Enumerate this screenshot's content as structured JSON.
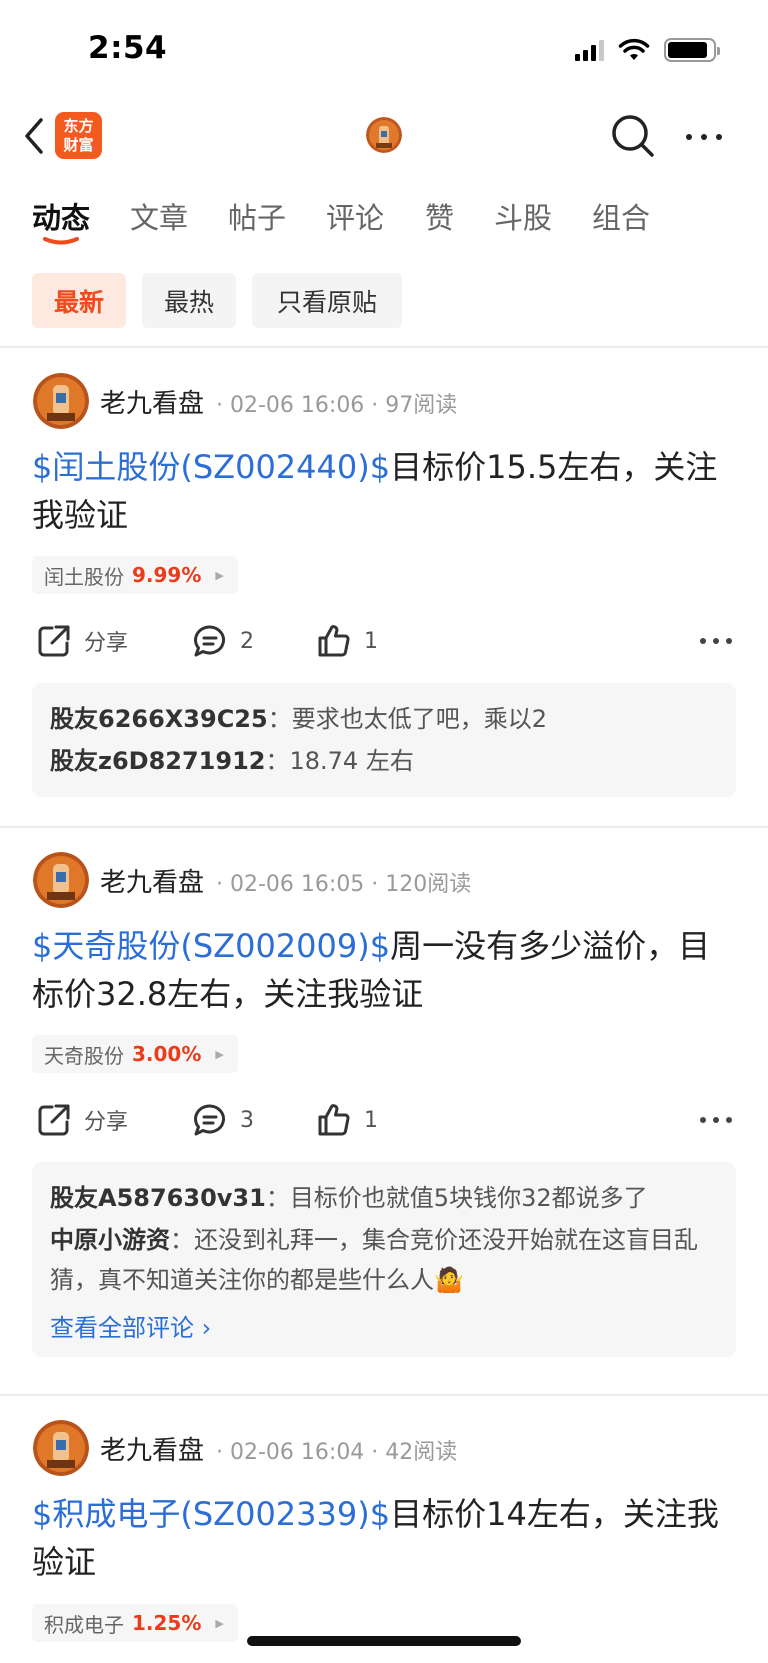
{
  "status_bar": {
    "time": "2:54"
  },
  "nav": {
    "logo_line1": "东方",
    "logo_line2": "财富"
  },
  "tabs": [
    {
      "label": "动态",
      "active": true
    },
    {
      "label": "文章"
    },
    {
      "label": "帖子"
    },
    {
      "label": "评论"
    },
    {
      "label": "赞"
    },
    {
      "label": "斗股"
    },
    {
      "label": "组合"
    }
  ],
  "filters": [
    {
      "label": "最新",
      "active": true
    },
    {
      "label": "最热"
    },
    {
      "label": "只看原贴"
    }
  ],
  "colors": {
    "accent": "#ef4b1d",
    "link": "#2b6fd6",
    "stock_up": "#ea3b1a"
  },
  "posts": [
    {
      "author": "老九看盘",
      "meta": "· 02-06 16:06 · 97阅读",
      "stock_tag": "$闰土股份(SZ002440)$",
      "text": "目标价15.5左右，关注我验证",
      "chip_name": "闰土股份",
      "chip_pct": "9.99%",
      "share_label": "分享",
      "comment_count": "2",
      "like_count": "1",
      "comments": [
        {
          "name": "股友6266X39C25",
          "sep": "：",
          "text": "要求也太低了吧，乘以2"
        },
        {
          "name": "股友z6D8271912",
          "sep": "：",
          "text": "18.74 左右"
        }
      ]
    },
    {
      "author": "老九看盘",
      "meta": "· 02-06 16:05 · 120阅读",
      "stock_tag": "$天奇股份(SZ002009)$",
      "text": "周一没有多少溢价，目标价32.8左右，关注我验证",
      "chip_name": "天奇股份",
      "chip_pct": "3.00%",
      "share_label": "分享",
      "comment_count": "3",
      "like_count": "1",
      "comments": [
        {
          "name": "股友A587630v31",
          "sep": "：",
          "text": "目标价也就值5块钱你32都说多了"
        },
        {
          "name": "中原小游资",
          "sep": "：",
          "text": "还没到礼拜一，集合竞价还没开始就在这盲目乱猜，真不知道关注你的都是些什么人🤷"
        }
      ],
      "view_all": "查看全部评论 ›"
    },
    {
      "author": "老九看盘",
      "meta": "· 02-06 16:04 · 42阅读",
      "stock_tag": "$积成电子(SZ002339)$",
      "text": "目标价14左右，关注我验证",
      "chip_name": "积成电子",
      "chip_pct": "1.25%"
    }
  ]
}
